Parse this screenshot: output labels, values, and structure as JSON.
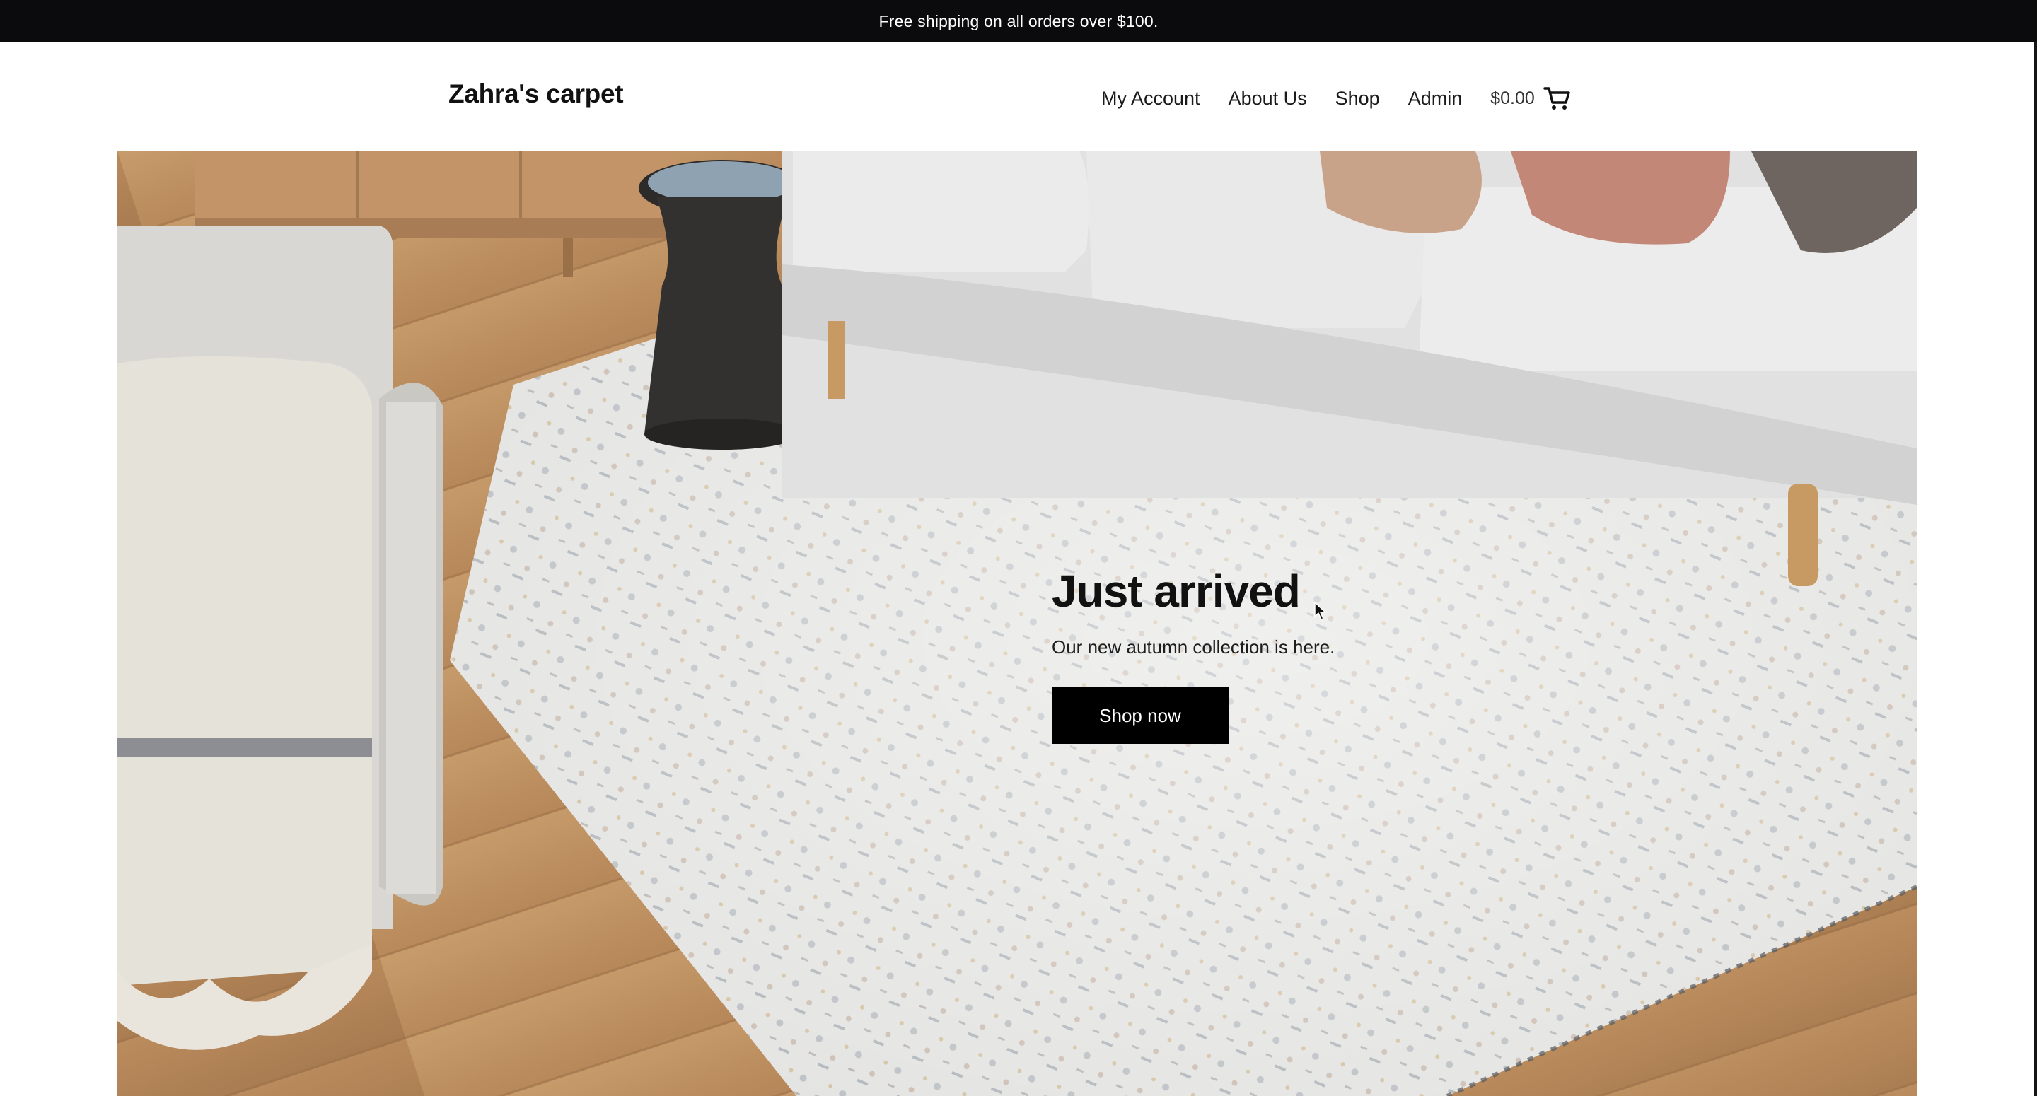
{
  "announcement": {
    "text": "Free shipping on all orders over $100."
  },
  "header": {
    "logo": "Zahra's carpet",
    "nav": [
      {
        "label": "My Account"
      },
      {
        "label": "About Us"
      },
      {
        "label": "Shop"
      },
      {
        "label": "Admin"
      }
    ],
    "cart": {
      "total": "$0.00",
      "icon": "cart-icon"
    }
  },
  "hero": {
    "title": "Just arrived",
    "subtitle": "Our new autumn collection is here.",
    "button_label": "Shop now",
    "image": "living-room-rug-photo"
  },
  "colors": {
    "announcement_bg": "#0b0b0d",
    "button_bg": "#000000",
    "button_text": "#ffffff",
    "text": "#111111"
  }
}
